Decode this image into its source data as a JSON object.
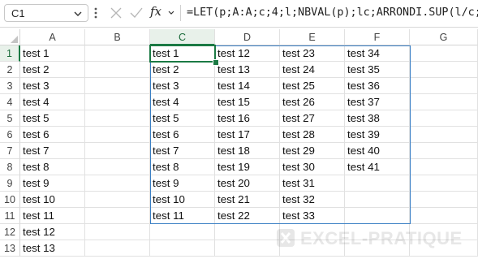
{
  "formula_bar": {
    "name_box": "C1",
    "fx_label": "fx",
    "formula": "=LET(p;A:A;c;4;l;NBVAL(p);lc;ARRONDI.SUP(l/c;"
  },
  "columns": [
    "A",
    "B",
    "C",
    "D",
    "E",
    "F",
    "G"
  ],
  "rows": [
    "1",
    "2",
    "3",
    "4",
    "5",
    "6",
    "7",
    "8",
    "9",
    "10",
    "11",
    "12",
    "13"
  ],
  "column_a": [
    "test 1",
    "test 2",
    "test 3",
    "test 4",
    "test 5",
    "test 6",
    "test 7",
    "test 8",
    "test 9",
    "test 10",
    "test 11",
    "test 12",
    "test 13"
  ],
  "spill": {
    "C": [
      "test 1",
      "test 2",
      "test 3",
      "test 4",
      "test 5",
      "test 6",
      "test 7",
      "test 8",
      "test 9",
      "test 10",
      "test 11"
    ],
    "D": [
      "test 12",
      "test 13",
      "test 14",
      "test 15",
      "test 16",
      "test 17",
      "test 18",
      "test 19",
      "test 20",
      "test 21",
      "test 22"
    ],
    "E": [
      "test 23",
      "test 24",
      "test 25",
      "test 26",
      "test 27",
      "test 28",
      "test 29",
      "test 30",
      "test 31",
      "test 32",
      "test 33"
    ],
    "F": [
      "test 34",
      "test 35",
      "test 36",
      "test 37",
      "test 38",
      "test 39",
      "test 40",
      "test 41",
      "",
      "",
      ""
    ]
  },
  "selected_cell": "C1",
  "watermark": "EXCEL-PRATIQUE",
  "colors": {
    "accent_green": "#1b7a44",
    "spill_border": "#3a7fc4",
    "header_selected_bg": "#e8f1ea"
  }
}
